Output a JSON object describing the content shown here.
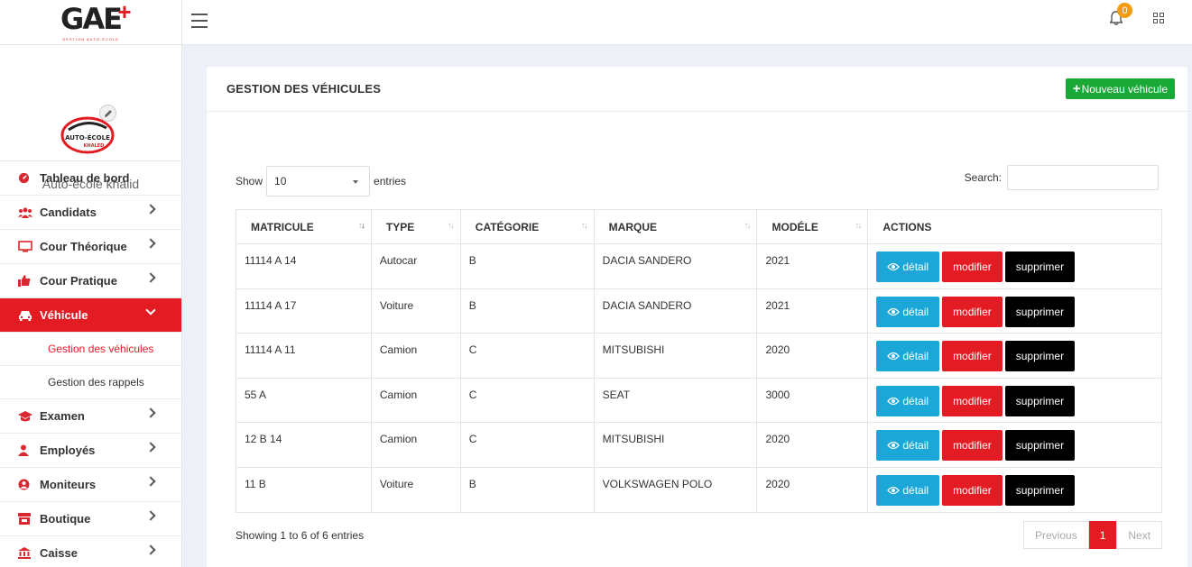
{
  "brand": {
    "logo_text": "GAE",
    "plus": "+",
    "tagline": "GESTION AUTO-ÉCOLE",
    "badge": "PLUS"
  },
  "profile": {
    "school_name": "Auto-école khalid",
    "logo_line1": "AUTO-ÉCOLE",
    "logo_line2": "KHALED"
  },
  "sidebar": {
    "items": [
      {
        "label": "Tableau de bord",
        "icon": "dashboard-icon"
      },
      {
        "label": "Candidats",
        "icon": "users-icon"
      },
      {
        "label": "Cour Théorique",
        "icon": "monitor-icon"
      },
      {
        "label": "Cour Pratique",
        "icon": "thumbs-up-icon"
      },
      {
        "label": "Véhicule",
        "icon": "car-icon"
      },
      {
        "label": "Examen",
        "icon": "graduation-cap-icon"
      },
      {
        "label": "Employés",
        "icon": "user-icon"
      },
      {
        "label": "Moniteurs",
        "icon": "user-circle-icon"
      },
      {
        "label": "Boutique",
        "icon": "store-icon"
      },
      {
        "label": "Caisse",
        "icon": "bank-icon"
      }
    ],
    "sub_items": [
      {
        "label": "Gestion des véhicules"
      },
      {
        "label": "Gestion des rappels"
      }
    ]
  },
  "topbar": {
    "notification_count": "0"
  },
  "card": {
    "title": "GESTION DES VÉHICULES",
    "new_button": "Nouveau véhicule",
    "new_button_plus": "+"
  },
  "controls": {
    "show_label": "Show",
    "page_size": "10",
    "entries_label": "entries",
    "search_label": "Search:"
  },
  "table": {
    "headers": [
      "MATRICULE",
      "TYPE",
      "CATÉGORIE",
      "MARQUE",
      "MODÉLE",
      "ACTIONS"
    ],
    "rows": [
      {
        "matricule": "11114 A 14",
        "type": "Autocar",
        "categorie": "B",
        "marque": "DACIA SANDERO",
        "modele": "2021"
      },
      {
        "matricule": "11114 A 17",
        "type": "Voiture",
        "categorie": "B",
        "marque": "DACIA SANDERO",
        "modele": "2021"
      },
      {
        "matricule": "11114 A 11",
        "type": "Camion",
        "categorie": "C",
        "marque": "MITSUBISHI",
        "modele": "2020"
      },
      {
        "matricule": "55 A",
        "type": "Camion",
        "categorie": "C",
        "marque": "SEAT",
        "modele": "3000"
      },
      {
        "matricule": "12 B 14",
        "type": "Camion",
        "categorie": "C",
        "marque": "MITSUBISHI",
        "modele": "2020"
      },
      {
        "matricule": "11 B",
        "type": "Voiture",
        "categorie": "B",
        "marque": "VOLKSWAGEN POLO",
        "modele": "2020"
      }
    ],
    "actions": {
      "detail": "détail",
      "modify": "modifier",
      "delete": "supprimer"
    }
  },
  "footer": {
    "info": "Showing 1 to 6 of 6 entries",
    "previous": "Previous",
    "current_page": "1",
    "next": "Next"
  },
  "colors": {
    "accent": "#e31b23",
    "success": "#1aa837",
    "info": "#1ba8d8",
    "warning": "#f39c12"
  }
}
